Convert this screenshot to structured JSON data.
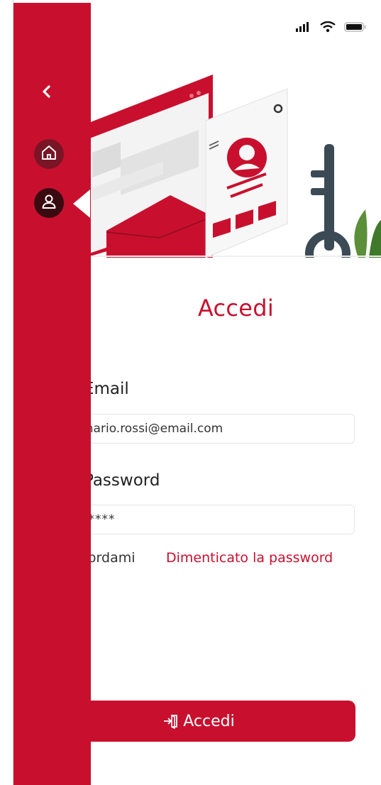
{
  "status_bar": {
    "icons": [
      "signal-icon",
      "wifi-icon",
      "battery-icon"
    ]
  },
  "sidebar": {
    "back_icon": "chevron-left-icon",
    "items": [
      {
        "icon": "home-icon",
        "selected": false
      },
      {
        "icon": "user-icon",
        "selected": true
      }
    ]
  },
  "hero": {
    "illustration": "login-security-illustration"
  },
  "login": {
    "title": "Accedi",
    "email_label": "Email",
    "email_value": "mario.rossi@email.com",
    "password_label": "Password",
    "password_value": "*****",
    "remember_label": "Ricordami",
    "forgot_link": "Dimenticato la password",
    "submit_label": "Accedi",
    "submit_icon": "login-icon"
  },
  "colors": {
    "brand": "#c8102e",
    "sidebar_home_bg": "#7a1526",
    "sidebar_selected_bg": "#3a0a11",
    "text": "#222222"
  }
}
